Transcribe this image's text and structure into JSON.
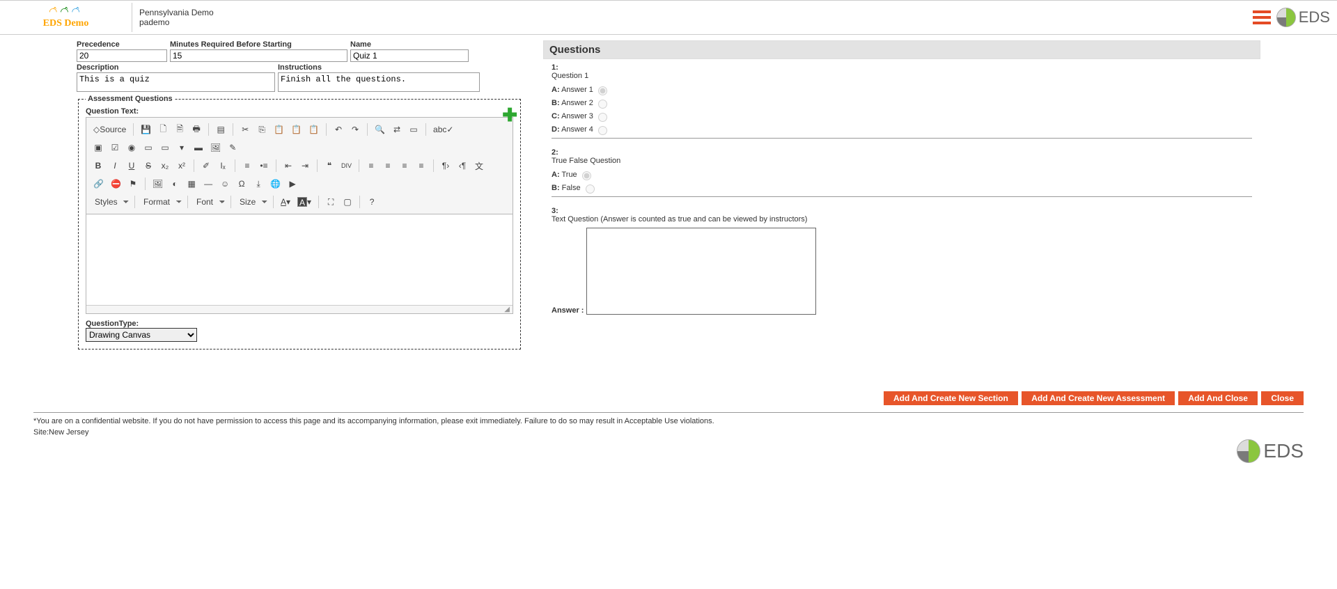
{
  "header": {
    "logo_text": "EDS Demo",
    "org_name": "Pennsylvania Demo",
    "org_code": "pademo",
    "eds_label": "EDS"
  },
  "fields": {
    "precedence": {
      "label": "Precedence",
      "value": "20"
    },
    "minutes": {
      "label": "Minutes Required Before Starting",
      "value": "15"
    },
    "name": {
      "label": "Name",
      "value": "Quiz 1"
    },
    "description": {
      "label": "Description",
      "value": "This is a quiz"
    },
    "instructions": {
      "label": "Instructions",
      "value": "Finish all the questions."
    }
  },
  "assessment": {
    "legend": "Assessment Questions",
    "question_text_label": "Question Text:",
    "qtype_label": "QuestionType:",
    "qtype_value": "Drawing Canvas"
  },
  "toolbar": {
    "source": "Source",
    "styles": "Styles",
    "format": "Format",
    "font": "Font",
    "size": "Size",
    "help": "?"
  },
  "questions_panel": {
    "title": "Questions",
    "items": [
      {
        "num": "1:",
        "text": "Question 1",
        "type": "mc",
        "options": [
          {
            "lett": "A:",
            "label": "Answer 1",
            "checked": true
          },
          {
            "lett": "B:",
            "label": "Answer 2",
            "checked": false
          },
          {
            "lett": "C:",
            "label": "Answer 3",
            "checked": false
          },
          {
            "lett": "D:",
            "label": "Answer 4",
            "checked": false
          }
        ]
      },
      {
        "num": "2:",
        "text": "True False Question",
        "type": "tf",
        "options": [
          {
            "lett": "A:",
            "label": "True",
            "checked": true
          },
          {
            "lett": "B:",
            "label": "False",
            "checked": false
          }
        ]
      },
      {
        "num": "3:",
        "text": "Text Question (Answer is counted as true and can be viewed by instructors)",
        "type": "text",
        "answer_label": "Answer :"
      }
    ]
  },
  "footer_buttons": {
    "add_section": "Add And Create New Section",
    "add_assessment": "Add And Create New Assessment",
    "add_close": "Add And Close",
    "close": "Close"
  },
  "footer": {
    "disclaimer": "*You are on a confidential website. If you do not have permission to access this page and its accompanying information, please exit immediately. Failure to do so may result in Acceptable Use violations.",
    "site": "Site:New Jersey",
    "eds_label": "EDS"
  },
  "icons": {
    "save": "💾",
    "new": "🗋",
    "preview": "🗎",
    "print": "🖶",
    "template": "▤",
    "cut": "✂",
    "copy": "⎘",
    "paste": "📋",
    "paste_text": "📋",
    "paste_word": "📋",
    "undo": "↶",
    "redo": "↷",
    "find": "🔍",
    "replace": "⇄",
    "selectall": "▭",
    "spell": "abc✓",
    "form": "▣",
    "checkbox": "☑",
    "radio": "◉",
    "textfield": "▭",
    "textarea": "▭",
    "select": "▾",
    "button": "▬",
    "image_btn": "🖼",
    "hidden": "✎",
    "bold": "B",
    "italic": "I",
    "underline": "U",
    "strike": "S",
    "sub": "x₂",
    "sup": "x²",
    "eraser": "✐",
    "removefmt": "Iₓ",
    "ol": "≡",
    "ul": "•≡",
    "outdent": "⇤",
    "indent": "⇥",
    "quote": "❝",
    "div": "DIV",
    "al": "≡",
    "ac": "≡",
    "ar": "≡",
    "aj": "≡",
    "ltr": "¶›",
    "rtl": "‹¶",
    "lang": "文",
    "link": "🔗",
    "unlink": "⛔",
    "anchor": "⚑",
    "image": "🖼",
    "flash": "◐",
    "table": "▦",
    "hr": "—",
    "smiley": "☺",
    "special": "Ω",
    "pagebreak": "⤓",
    "iframe": "🌐",
    "embed": "▶",
    "textcolor": "A",
    "bgcolor": "A",
    "max": "⛶",
    "blocks": "▢"
  }
}
